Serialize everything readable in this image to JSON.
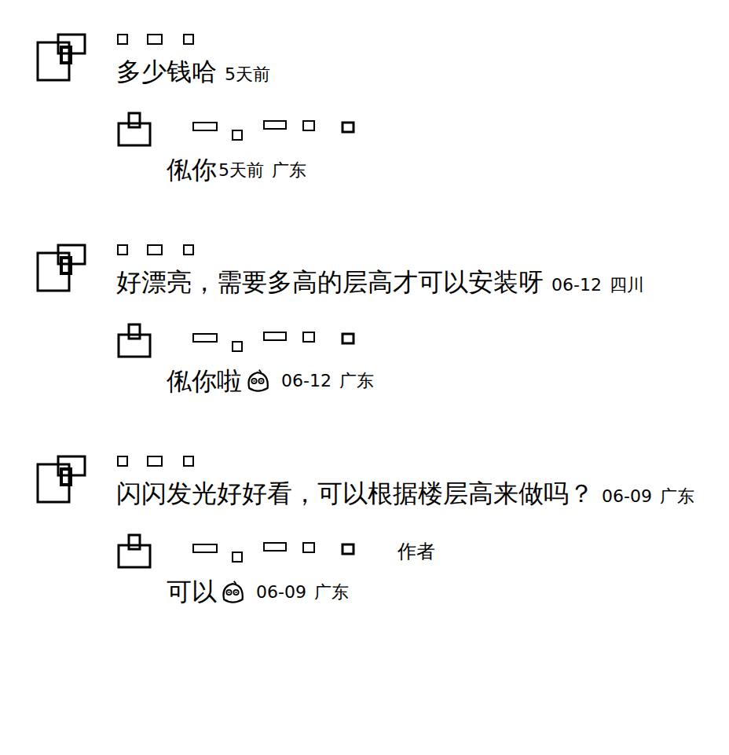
{
  "comments": [
    {
      "text": "多少钱哈",
      "time": "5天前",
      "location": "",
      "reply": {
        "text": "俬你",
        "emoji": false,
        "time": "5天前",
        "location": "广东",
        "badge": ""
      }
    },
    {
      "text": "好漂亮，需要多高的层高才可以安装呀",
      "time": "06-12",
      "location": "四川",
      "reply": {
        "text": "俬你啦",
        "emoji": true,
        "time": "06-12",
        "location": "广东",
        "badge": ""
      }
    },
    {
      "text": "闪闪发光好好看，可以根据楼层高来做吗？",
      "time": "06-09",
      "location": "广东",
      "reply": {
        "text": "可以",
        "emoji": true,
        "time": "06-09",
        "location": "广东",
        "badge": "作者"
      }
    }
  ]
}
